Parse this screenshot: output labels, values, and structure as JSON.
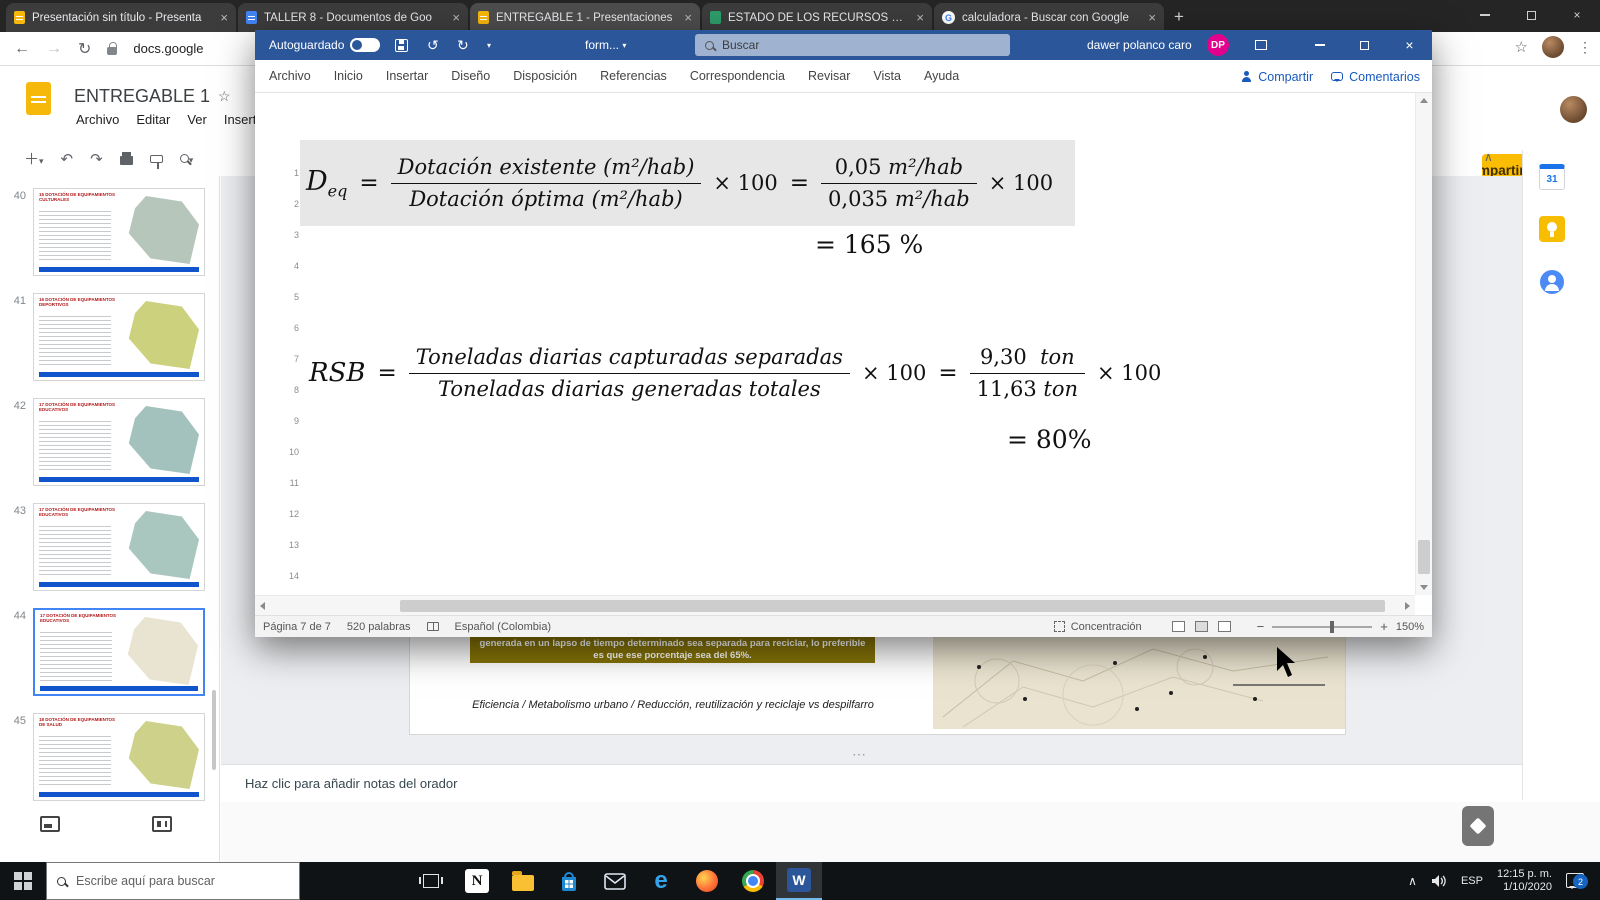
{
  "browser": {
    "tabs": [
      {
        "title": "Presentación sin título - Presenta",
        "favicon_color": "#f6b80b"
      },
      {
        "title": "TALLER 8 - Documentos de Goo",
        "favicon_color": "#4285f4"
      },
      {
        "title": "ENTREGABLE 1 - Presentaciones",
        "favicon_color": "#f6b80b"
      },
      {
        "title": "ESTADO DE LOS RECURSOS NAT",
        "favicon_color": "#2e9e6b"
      },
      {
        "title": "calculadora - Buscar con Google",
        "favicon_letter": "G"
      }
    ],
    "url_text": "docs.google"
  },
  "slides_app": {
    "doc_title": "ENTREGABLE 1",
    "menus": [
      "Archivo",
      "Editar",
      "Ver",
      "Insertar"
    ],
    "share_button": "Compartir",
    "calendar_day": "31",
    "filmstrip": [
      {
        "number": "40",
        "title": "15 DOTACIÓN DE EQUIPAMIENTOS CULTURALES",
        "map_color": "#b7c6bb"
      },
      {
        "number": "41",
        "title": "16 DOTACIÓN DE EQUIPAMIENTOS DEPORTIVOS",
        "map_color": "#ccd17d"
      },
      {
        "number": "42",
        "title": "17 DOTACIÓN DE EQUIPAMIENTOS EDUCATIVOS",
        "map_color": "#a3c2bd"
      },
      {
        "number": "43",
        "title": "17 DOTACIÓN DE EQUIPAMIENTOS EDUCATIVOS",
        "map_color": "#a9c6bf"
      },
      {
        "number": "44",
        "title": "17 DOTACIÓN DE EQUIPAMIENTOS EDUCATIVOS",
        "map_color": "#e9e4d1"
      },
      {
        "number": "45",
        "title": "18 DOTACIÓN DE EQUIPAMIENTOS DE SALUD",
        "map_color": "#cdd189"
      }
    ],
    "slide": {
      "highlight_text": "generada en un lapso de tiempo determinado sea separada para reciclar, lo preferible es que ese porcentaje sea del 65%.",
      "caption": "Eficiencia / Metabolismo urbano / Reducción, reutilización y reciclaje vs despilfarro"
    },
    "notes_placeholder": "Haz clic para añadir notas del orador"
  },
  "word_app": {
    "titlebar": {
      "autosave": "Autoguardado",
      "doc_name": "form...",
      "search_placeholder": "Buscar",
      "user": "dawer polanco caro",
      "avatar": "DP"
    },
    "menus": [
      "Archivo",
      "Inicio",
      "Insertar",
      "Diseño",
      "Disposición",
      "Referencias",
      "Correspondencia",
      "Revisar",
      "Vista",
      "Ayuda"
    ],
    "share": "Compartir",
    "comments": "Comentarios",
    "ruler": "1\n2\n3\n4\n5\n6\n7\n8\n9\n10\n11\n12\n13\n14",
    "formula1": {
      "lhs": "D",
      "lhs_sub": "eq",
      "eq": "=",
      "f1_num": "Dotación existente (m²/hab)",
      "f1_den": "Dotación óptima (m²/hab)",
      "times": "× 100",
      "eq2": "=",
      "f2_num_val": "0,05",
      "f2_num_unit": "m²/hab",
      "f2_den_val": "0,035",
      "f2_den_unit": "m²/hab",
      "times2": "× 100",
      "result": "= 165 %"
    },
    "formula2": {
      "lhs": "RSB",
      "eq": "=",
      "f1_num": "Toneladas diarias capturadas separadas",
      "f1_den": "Toneladas diarias generadas totales",
      "times": "× 100",
      "eq2": "=",
      "f2_num_val": "9,30",
      "f2_num_unit": "ton",
      "f2_den_val": "11,63",
      "f2_den_unit": "ton",
      "times2": "× 100",
      "result": "= 80%"
    },
    "statusbar": {
      "page": "Página 7 de 7",
      "words": "520 palabras",
      "language": "Español (Colombia)",
      "focus": "Concentración",
      "zoom": "150%"
    }
  },
  "taskbar": {
    "search_placeholder": "Escribe aquí para buscar",
    "notion_letter": "N",
    "edge_letter": "e",
    "word_letter": "W",
    "language": "ESP",
    "time": "12:15 p. m.",
    "date": "1/10/2020",
    "notification_count": "2"
  }
}
